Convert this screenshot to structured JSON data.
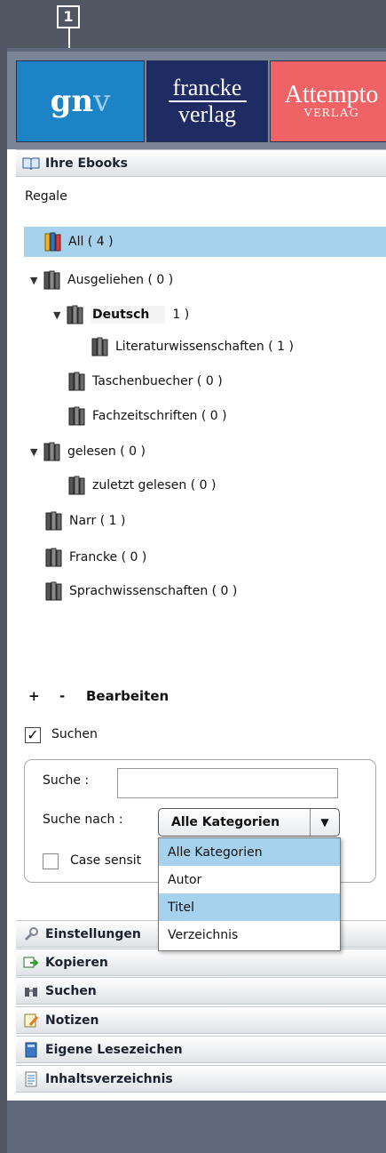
{
  "callout": "1",
  "logos": {
    "gnv_a": "gn",
    "gnv_b": "v",
    "francke_top": "francke",
    "francke_bottom": "verlag",
    "attempto_top": "Attempto",
    "attempto_bottom": "VERLAG"
  },
  "ebooks": {
    "header": "Ihre Ebooks",
    "regale_label": "Regale",
    "tree": [
      {
        "label": "All ( 4 )",
        "selected": true
      },
      {
        "label": "Ausgeliehen ( 0 )"
      },
      {
        "label": "Deutsch",
        "count_fragment": "1 )"
      },
      {
        "label": "Literaturwissenschaften ( 1 )"
      },
      {
        "label": "Taschenbuecher ( 0 )"
      },
      {
        "label": "Fachzeitschriften ( 0 )"
      },
      {
        "label": "gelesen ( 0 )"
      },
      {
        "label": "zuletzt gelesen ( 0 )"
      },
      {
        "label": "Narr ( 1 )"
      },
      {
        "label": "Francke ( 0 )"
      },
      {
        "label": "Sprachwissenschaften ( 0 )"
      }
    ],
    "controls": {
      "add": "+",
      "remove": "-",
      "edit": "Bearbeiten"
    }
  },
  "search": {
    "toggle_label": "Suchen",
    "toggle_checked": true,
    "query_label": "Suche :",
    "query_value": "",
    "scope_label": "Suche nach :",
    "scope_value": "Alle Kategorien",
    "case_label": "Case sensit",
    "options": [
      "Alle Kategorien",
      "Autor",
      "Titel",
      "Verzeichnis"
    ]
  },
  "sections": [
    {
      "label": "Einstellungen",
      "icon": "wrench-icon"
    },
    {
      "label": "Kopieren",
      "icon": "copy-icon"
    },
    {
      "label": "Suchen",
      "icon": "binoculars-icon"
    },
    {
      "label": "Notizen",
      "icon": "notes-icon"
    },
    {
      "label": "Eigene Lesezeichen",
      "icon": "bookmark-icon"
    },
    {
      "label": "Inhaltsverzeichnis",
      "icon": "toc-icon"
    }
  ],
  "colors": {
    "selection": "#a7d2ee",
    "frame": "#5f687a",
    "gnv": "#1b83c6",
    "francke": "#1f2b63",
    "attempto": "#ef6366"
  }
}
